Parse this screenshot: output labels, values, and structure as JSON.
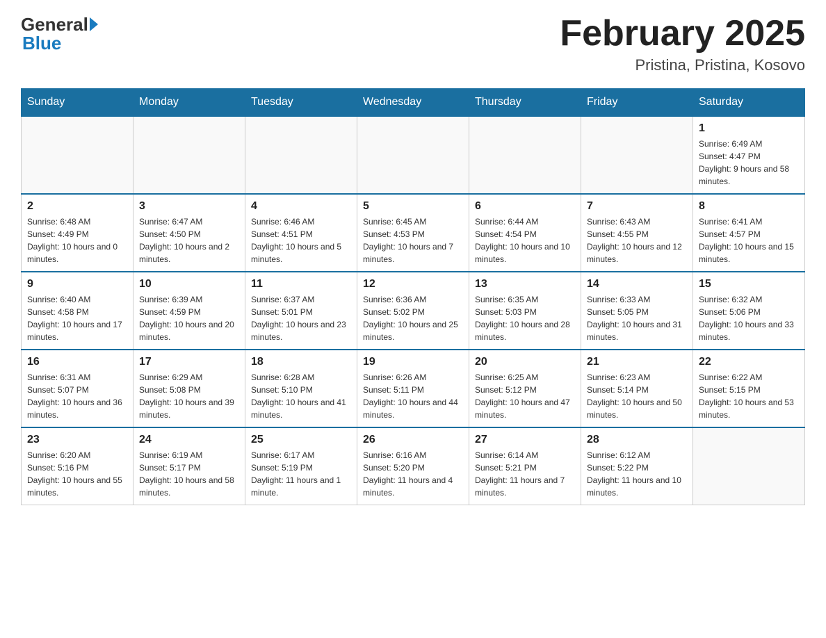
{
  "header": {
    "logo_general": "General",
    "logo_blue": "Blue",
    "month_title": "February 2025",
    "location": "Pristina, Pristina, Kosovo"
  },
  "days_of_week": [
    "Sunday",
    "Monday",
    "Tuesday",
    "Wednesday",
    "Thursday",
    "Friday",
    "Saturday"
  ],
  "weeks": [
    [
      {
        "day": "",
        "sunrise": "",
        "sunset": "",
        "daylight": ""
      },
      {
        "day": "",
        "sunrise": "",
        "sunset": "",
        "daylight": ""
      },
      {
        "day": "",
        "sunrise": "",
        "sunset": "",
        "daylight": ""
      },
      {
        "day": "",
        "sunrise": "",
        "sunset": "",
        "daylight": ""
      },
      {
        "day": "",
        "sunrise": "",
        "sunset": "",
        "daylight": ""
      },
      {
        "day": "",
        "sunrise": "",
        "sunset": "",
        "daylight": ""
      },
      {
        "day": "1",
        "sunrise": "Sunrise: 6:49 AM",
        "sunset": "Sunset: 4:47 PM",
        "daylight": "Daylight: 9 hours and 58 minutes."
      }
    ],
    [
      {
        "day": "2",
        "sunrise": "Sunrise: 6:48 AM",
        "sunset": "Sunset: 4:49 PM",
        "daylight": "Daylight: 10 hours and 0 minutes."
      },
      {
        "day": "3",
        "sunrise": "Sunrise: 6:47 AM",
        "sunset": "Sunset: 4:50 PM",
        "daylight": "Daylight: 10 hours and 2 minutes."
      },
      {
        "day": "4",
        "sunrise": "Sunrise: 6:46 AM",
        "sunset": "Sunset: 4:51 PM",
        "daylight": "Daylight: 10 hours and 5 minutes."
      },
      {
        "day": "5",
        "sunrise": "Sunrise: 6:45 AM",
        "sunset": "Sunset: 4:53 PM",
        "daylight": "Daylight: 10 hours and 7 minutes."
      },
      {
        "day": "6",
        "sunrise": "Sunrise: 6:44 AM",
        "sunset": "Sunset: 4:54 PM",
        "daylight": "Daylight: 10 hours and 10 minutes."
      },
      {
        "day": "7",
        "sunrise": "Sunrise: 6:43 AM",
        "sunset": "Sunset: 4:55 PM",
        "daylight": "Daylight: 10 hours and 12 minutes."
      },
      {
        "day": "8",
        "sunrise": "Sunrise: 6:41 AM",
        "sunset": "Sunset: 4:57 PM",
        "daylight": "Daylight: 10 hours and 15 minutes."
      }
    ],
    [
      {
        "day": "9",
        "sunrise": "Sunrise: 6:40 AM",
        "sunset": "Sunset: 4:58 PM",
        "daylight": "Daylight: 10 hours and 17 minutes."
      },
      {
        "day": "10",
        "sunrise": "Sunrise: 6:39 AM",
        "sunset": "Sunset: 4:59 PM",
        "daylight": "Daylight: 10 hours and 20 minutes."
      },
      {
        "day": "11",
        "sunrise": "Sunrise: 6:37 AM",
        "sunset": "Sunset: 5:01 PM",
        "daylight": "Daylight: 10 hours and 23 minutes."
      },
      {
        "day": "12",
        "sunrise": "Sunrise: 6:36 AM",
        "sunset": "Sunset: 5:02 PM",
        "daylight": "Daylight: 10 hours and 25 minutes."
      },
      {
        "day": "13",
        "sunrise": "Sunrise: 6:35 AM",
        "sunset": "Sunset: 5:03 PM",
        "daylight": "Daylight: 10 hours and 28 minutes."
      },
      {
        "day": "14",
        "sunrise": "Sunrise: 6:33 AM",
        "sunset": "Sunset: 5:05 PM",
        "daylight": "Daylight: 10 hours and 31 minutes."
      },
      {
        "day": "15",
        "sunrise": "Sunrise: 6:32 AM",
        "sunset": "Sunset: 5:06 PM",
        "daylight": "Daylight: 10 hours and 33 minutes."
      }
    ],
    [
      {
        "day": "16",
        "sunrise": "Sunrise: 6:31 AM",
        "sunset": "Sunset: 5:07 PM",
        "daylight": "Daylight: 10 hours and 36 minutes."
      },
      {
        "day": "17",
        "sunrise": "Sunrise: 6:29 AM",
        "sunset": "Sunset: 5:08 PM",
        "daylight": "Daylight: 10 hours and 39 minutes."
      },
      {
        "day": "18",
        "sunrise": "Sunrise: 6:28 AM",
        "sunset": "Sunset: 5:10 PM",
        "daylight": "Daylight: 10 hours and 41 minutes."
      },
      {
        "day": "19",
        "sunrise": "Sunrise: 6:26 AM",
        "sunset": "Sunset: 5:11 PM",
        "daylight": "Daylight: 10 hours and 44 minutes."
      },
      {
        "day": "20",
        "sunrise": "Sunrise: 6:25 AM",
        "sunset": "Sunset: 5:12 PM",
        "daylight": "Daylight: 10 hours and 47 minutes."
      },
      {
        "day": "21",
        "sunrise": "Sunrise: 6:23 AM",
        "sunset": "Sunset: 5:14 PM",
        "daylight": "Daylight: 10 hours and 50 minutes."
      },
      {
        "day": "22",
        "sunrise": "Sunrise: 6:22 AM",
        "sunset": "Sunset: 5:15 PM",
        "daylight": "Daylight: 10 hours and 53 minutes."
      }
    ],
    [
      {
        "day": "23",
        "sunrise": "Sunrise: 6:20 AM",
        "sunset": "Sunset: 5:16 PM",
        "daylight": "Daylight: 10 hours and 55 minutes."
      },
      {
        "day": "24",
        "sunrise": "Sunrise: 6:19 AM",
        "sunset": "Sunset: 5:17 PM",
        "daylight": "Daylight: 10 hours and 58 minutes."
      },
      {
        "day": "25",
        "sunrise": "Sunrise: 6:17 AM",
        "sunset": "Sunset: 5:19 PM",
        "daylight": "Daylight: 11 hours and 1 minute."
      },
      {
        "day": "26",
        "sunrise": "Sunrise: 6:16 AM",
        "sunset": "Sunset: 5:20 PM",
        "daylight": "Daylight: 11 hours and 4 minutes."
      },
      {
        "day": "27",
        "sunrise": "Sunrise: 6:14 AM",
        "sunset": "Sunset: 5:21 PM",
        "daylight": "Daylight: 11 hours and 7 minutes."
      },
      {
        "day": "28",
        "sunrise": "Sunrise: 6:12 AM",
        "sunset": "Sunset: 5:22 PM",
        "daylight": "Daylight: 11 hours and 10 minutes."
      },
      {
        "day": "",
        "sunrise": "",
        "sunset": "",
        "daylight": ""
      }
    ]
  ]
}
